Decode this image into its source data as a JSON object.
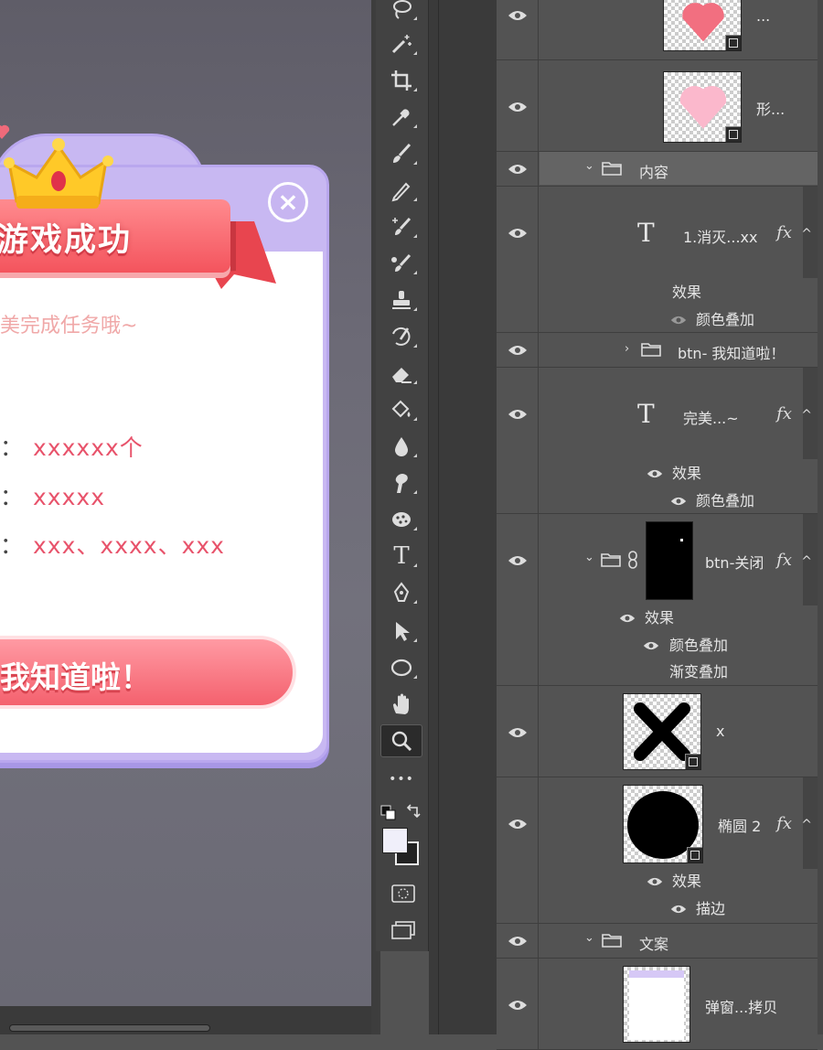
{
  "canvas": {
    "title": "游戏成功",
    "subtitle": "美完成任务哦~",
    "rows": [
      {
        "colon": "：",
        "value": "xxxxxx个"
      },
      {
        "colon": "：",
        "value": "xxxxx"
      },
      {
        "colon": "：",
        "value": "xxx、xxxx、xxx"
      }
    ],
    "button_label": "我知道啦！",
    "close_glyph": "×"
  },
  "tools": [
    {
      "name": "lasso-tool-icon"
    },
    {
      "name": "magic-wand-tool-icon"
    },
    {
      "name": "crop-tool-icon"
    },
    {
      "name": "eyedropper-tool-icon"
    },
    {
      "name": "brush-tool-icon"
    },
    {
      "name": "pencil-tool-icon"
    },
    {
      "name": "color-replacement-tool-icon"
    },
    {
      "name": "mixer-brush-tool-icon"
    },
    {
      "name": "clone-stamp-tool-icon"
    },
    {
      "name": "history-brush-tool-icon"
    },
    {
      "name": "eraser-tool-icon"
    },
    {
      "name": "paint-bucket-tool-icon"
    },
    {
      "name": "blur-tool-icon"
    },
    {
      "name": "smudge-tool-icon"
    },
    {
      "name": "sponge-tool-icon"
    },
    {
      "name": "type-tool-icon"
    },
    {
      "name": "pen-tool-icon"
    },
    {
      "name": "path-selection-tool-icon"
    },
    {
      "name": "ellipse-tool-icon"
    },
    {
      "name": "hand-tool-icon"
    },
    {
      "name": "zoom-tool-icon",
      "active": true
    },
    {
      "name": "more-tools-icon"
    }
  ],
  "tool_glyphs": {
    "type": "T",
    "more": "•••"
  },
  "swatches": {
    "foreground": "#f0effa",
    "background": "#222222"
  },
  "layers": {
    "top_partial_name": "...",
    "shape_layer_name": "形...",
    "group_content": "内容",
    "text_layer_1": "1.消灭...xx",
    "effects_label": "效果",
    "color_overlay": "颜色叠加",
    "group_btn_ok": "btn- 我知道啦！",
    "text_layer_2": "完美...~",
    "btn_close": "btn-关闭",
    "gradient_overlay": "渐变叠加",
    "x_layer": "x",
    "ellipse_layer": "椭圆 2",
    "stroke": "描边",
    "group_copy": "文案",
    "popup_copy": "弹窗...拷贝",
    "fx": "fx"
  },
  "colors": {
    "accent_pink": "#f4545d",
    "panel_purple": "#c8b8f2",
    "red_text": "#e8536b"
  }
}
